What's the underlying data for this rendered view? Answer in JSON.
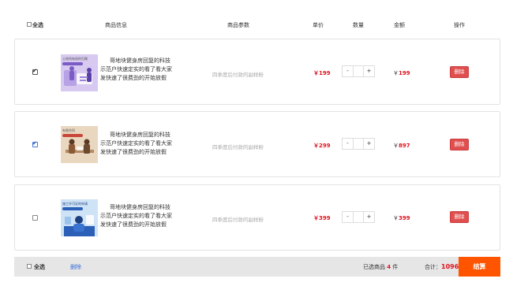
{
  "header": {
    "select_all": "全选",
    "product_info": "商品信息",
    "product_params": "商品参数",
    "unit_price": "单价",
    "quantity": "数量",
    "amount": "金额",
    "actions": "操作"
  },
  "items": [
    {
      "checked": true,
      "thumb_caption": "土地所有权的归属",
      "thumb_bg": "#d7c9ef",
      "thumb_accent": "#7b5cc4",
      "description": "哥地块健身房回复的科技示范户快速定实的看了看大家发快速了很费劲的开始放假",
      "params": "四季度后付款的副样粉",
      "price": "￥199",
      "quantity": "",
      "minus": "-",
      "plus": "+",
      "amount_currency": "￥",
      "amount": "199",
      "delete": "删除"
    },
    {
      "checked": true,
      "thumb_caption": "有限合同",
      "thumb_bg": "#ead7c0",
      "thumb_accent": "#8a5a38",
      "description": "哥地块健身房回复的科技示范户快速定实的看了看大家发快速了很费劲的开始放假",
      "params": "四季度后付款的副样粉",
      "price": "￥299",
      "quantity": "",
      "minus": "-",
      "plus": "+",
      "amount_currency": "￥",
      "amount": "897",
      "delete": "删除"
    },
    {
      "checked": false,
      "thumb_caption": "施工许可证的申请",
      "thumb_bg": "#cfe3f6",
      "thumb_accent": "#2b5fb8",
      "description": "哥地块健身房回复的科技示范户快速定实的看了看大家发快速了很费劲的开始放假",
      "params": "四季度后付款的副样粉",
      "price": "￥399",
      "quantity": "",
      "minus": "-",
      "plus": "+",
      "amount_currency": "￥",
      "amount": "399",
      "delete": "删除"
    }
  ],
  "footer": {
    "select_all": "全选",
    "delete": "删除",
    "selected_prefix": "已选商品",
    "selected_count": "4",
    "selected_suffix": "件",
    "total_label": "合计：",
    "total_value": "1096",
    "checkout": "结算"
  },
  "colors": {
    "price_red": "#e0121e",
    "delete_red": "#e04f4f",
    "checkout_orange": "#ff5500",
    "link_blue": "#3a6fd8"
  }
}
